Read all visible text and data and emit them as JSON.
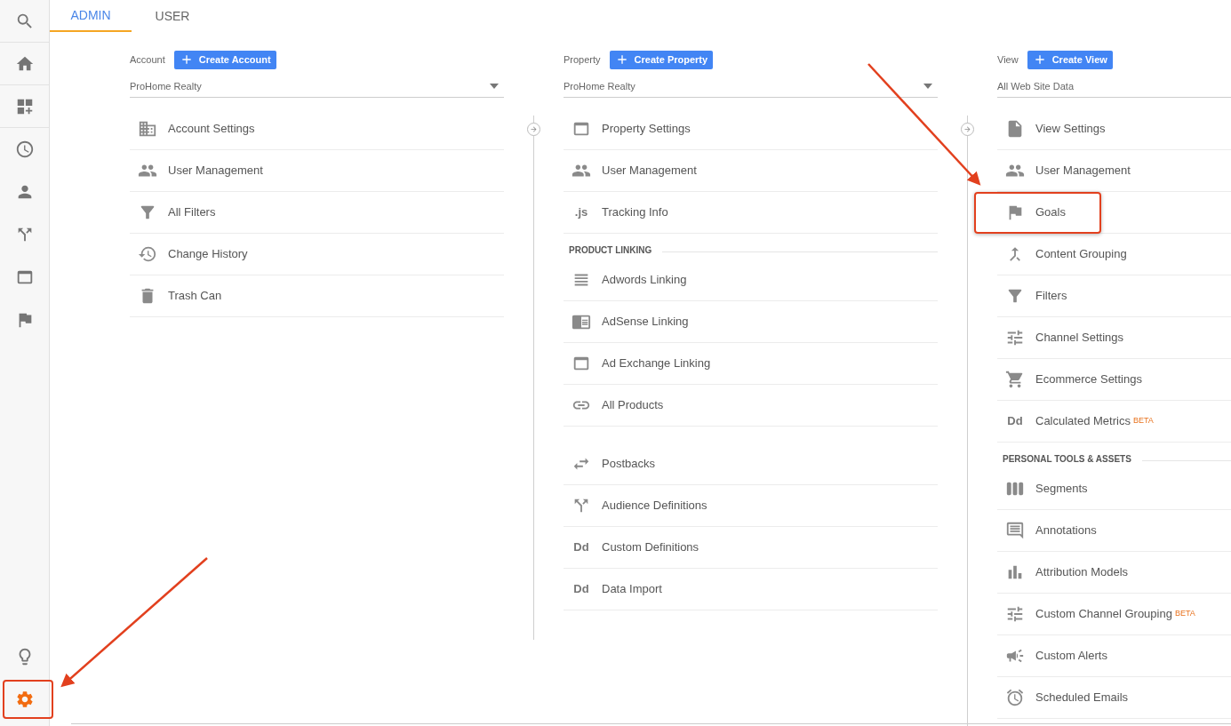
{
  "tabs": [
    {
      "label": "ADMIN",
      "selected": true
    },
    {
      "label": "USER",
      "selected": false
    }
  ],
  "sidebar": {
    "bottom_items": [
      {
        "selected": false,
        "highlighted": false
      },
      {
        "selected": true,
        "highlighted": true
      }
    ]
  },
  "columns": [
    {
      "label": "Account",
      "button": "Create Account",
      "dropdown": "ProHome Realty",
      "sections": [
        {
          "items": [
            {
              "label": "Account Settings",
              "highlighted": false
            },
            {
              "label": "User Management",
              "highlighted": false
            },
            {
              "label": "All Filters",
              "highlighted": false
            },
            {
              "label": "Change History",
              "highlighted": false
            },
            {
              "label": "Trash Can",
              "highlighted": false
            }
          ]
        }
      ]
    },
    {
      "label": "Property",
      "button": "Create Property",
      "dropdown": "ProHome Realty",
      "sections": [
        {
          "items": [
            {
              "label": "Property Settings",
              "highlighted": false
            },
            {
              "label": "User Management",
              "highlighted": false
            },
            {
              "label": "Tracking Info",
              "glyph": ".js",
              "highlighted": false
            }
          ]
        },
        {
          "title": "PRODUCT LINKING",
          "items": [
            {
              "label": "Adwords Linking",
              "highlighted": false
            },
            {
              "label": "AdSense Linking",
              "highlighted": false
            },
            {
              "label": "Ad Exchange Linking",
              "highlighted": false
            },
            {
              "label": "All Products",
              "highlighted": false
            }
          ]
        },
        {
          "items": [
            {
              "label": "Postbacks",
              "highlighted": false
            },
            {
              "label": "Audience Definitions",
              "highlighted": false
            },
            {
              "label": "Custom Definitions",
              "glyph": "Dd",
              "highlighted": false
            },
            {
              "label": "Data Import",
              "glyph": "Dd",
              "highlighted": false
            }
          ]
        }
      ]
    },
    {
      "label": "View",
      "button": "Create View",
      "dropdown": "All Web Site Data",
      "sections": [
        {
          "items": [
            {
              "label": "View Settings",
              "highlighted": false
            },
            {
              "label": "User Management",
              "highlighted": false
            },
            {
              "label": "Goals",
              "highlighted": true
            },
            {
              "label": "Content Grouping",
              "highlighted": false
            },
            {
              "label": "Filters",
              "highlighted": false
            },
            {
              "label": "Channel Settings",
              "highlighted": false
            },
            {
              "label": "Ecommerce Settings",
              "highlighted": false
            },
            {
              "label": "Calculated Metrics",
              "glyph": "Dd",
              "badge": "BETA",
              "highlighted": false
            }
          ]
        },
        {
          "title": "PERSONAL TOOLS & ASSETS",
          "items": [
            {
              "label": "Segments",
              "highlighted": false
            },
            {
              "label": "Annotations",
              "highlighted": false
            },
            {
              "label": "Attribution Models",
              "highlighted": false
            },
            {
              "label": "Custom Channel Grouping",
              "badge": "BETA",
              "highlighted": false
            },
            {
              "label": "Custom Alerts",
              "highlighted": false
            },
            {
              "label": "Scheduled Emails",
              "highlighted": false
            }
          ]
        }
      ]
    }
  ]
}
